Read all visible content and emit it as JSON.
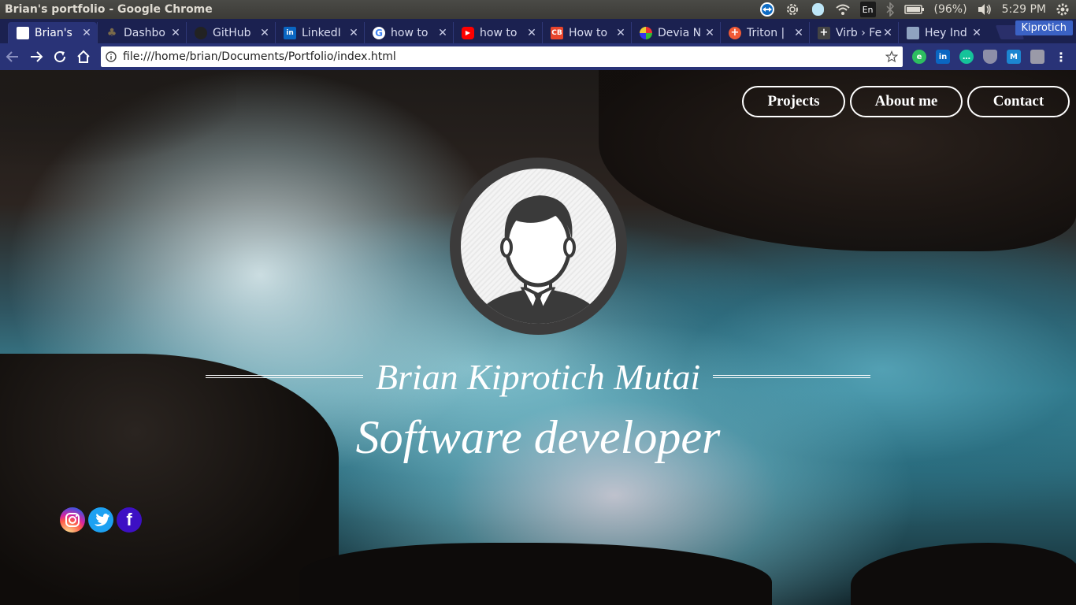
{
  "window": {
    "title": "Brian's portfolio - Google Chrome"
  },
  "tray": {
    "keyboard_layout": "En",
    "battery": "(96%)",
    "time": "5:29 PM",
    "icons": [
      "teamviewer-icon",
      "settings-gear-icon",
      "skype-icon",
      "wifi-icon",
      "keyboard-icon",
      "bluetooth-icon",
      "battery-icon",
      "volume-icon",
      "power-gear-icon"
    ]
  },
  "browser": {
    "profile_name": "Kiprotich",
    "tabs": [
      {
        "label": "Brian's",
        "favicon": "blank-page-icon",
        "active": true
      },
      {
        "label": "Dashbo",
        "favicon": "tree-icon"
      },
      {
        "label": "GitHub",
        "favicon": "github-icon"
      },
      {
        "label": "LinkedI",
        "favicon": "linkedin-icon"
      },
      {
        "label": "how to",
        "favicon": "google-icon"
      },
      {
        "label": "how to",
        "favicon": "youtube-icon"
      },
      {
        "label": "How to",
        "favicon": "codebeautify-icon"
      },
      {
        "label": "Devia N",
        "favicon": "deviantart-icon"
      },
      {
        "label": "Triton |",
        "favicon": "triton-icon"
      },
      {
        "label": "Virb › Fe",
        "favicon": "virb-icon"
      },
      {
        "label": "Hey Ind",
        "favicon": "indie-icon"
      }
    ],
    "url": "file:///home/brian/Documents/Portfolio/index.html",
    "extensions": [
      "evernote-icon",
      "linkedin-icon",
      "chat-bubble-icon",
      "shield-icon",
      "malwarebytes-icon",
      "lightbulb-icon"
    ]
  },
  "page": {
    "nav": {
      "projects": "Projects",
      "about": "About me",
      "contact": "Contact"
    },
    "name": "Brian Kiprotich Mutai",
    "role": "Software developer",
    "socials": [
      "instagram-icon",
      "twitter-icon",
      "facebook-icon"
    ],
    "facebook_glyph": "f"
  },
  "colors": {
    "tab_strip": "#1b2150",
    "toolbar": "#293377",
    "profile": "#3b62c4"
  }
}
